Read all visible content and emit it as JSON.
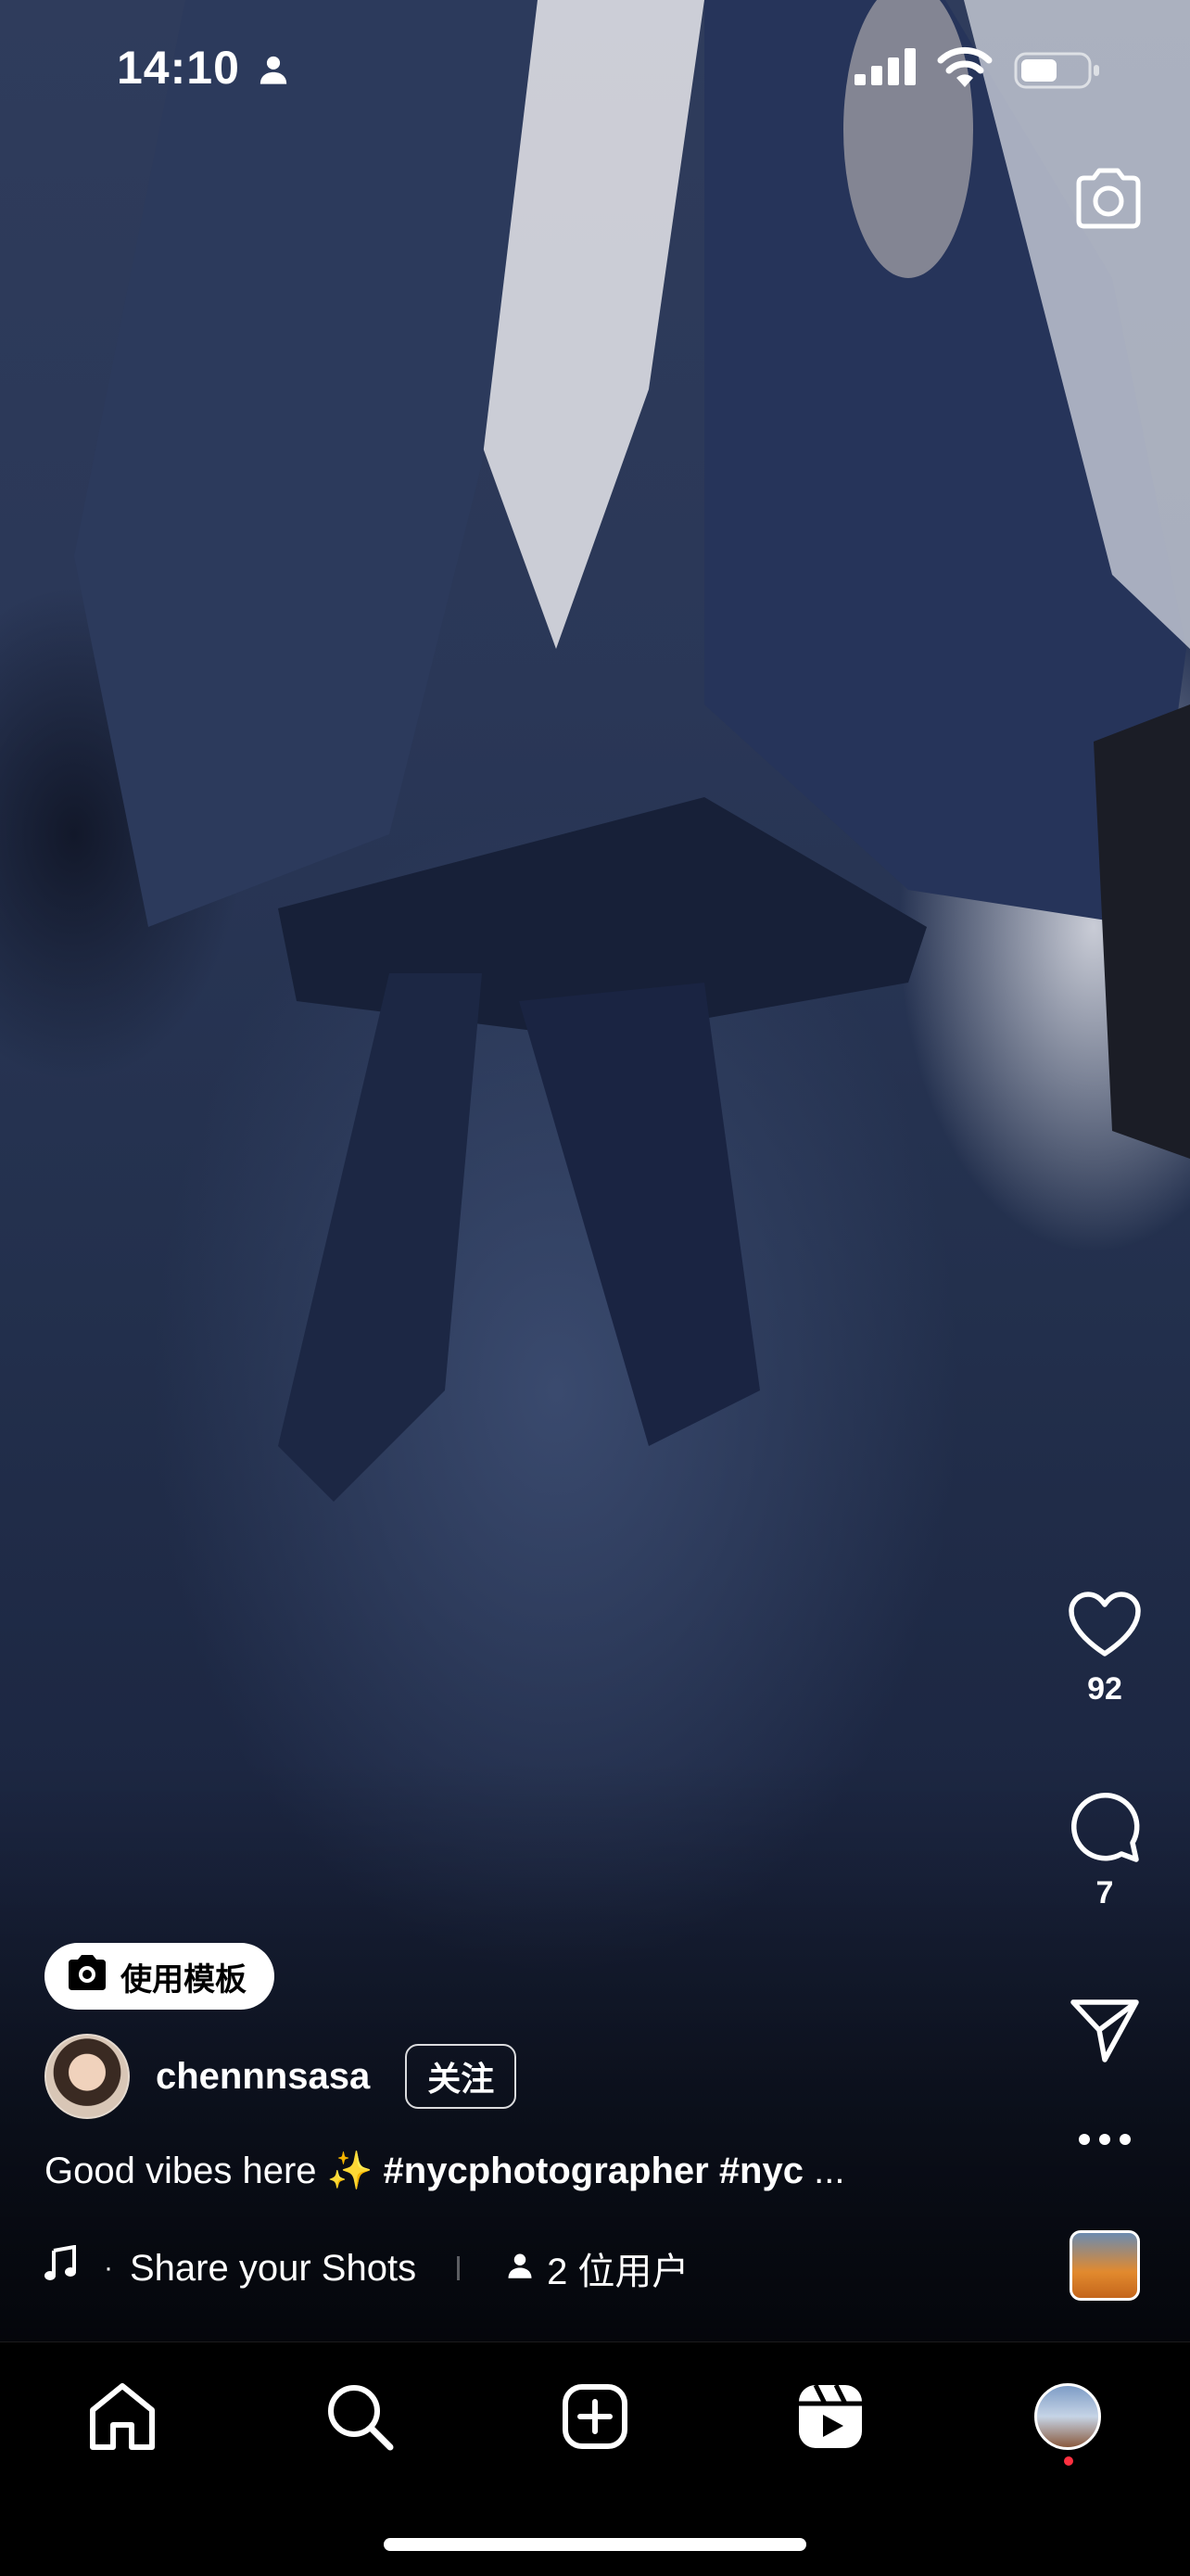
{
  "status_bar": {
    "time": "14:10"
  },
  "post": {
    "template_label": "使用模板",
    "username": "chennnsasa",
    "follow_label": "关注",
    "caption_text": "Good vibes here ✨ ",
    "caption_tags": "#nycphotographer #nyc",
    "caption_more": " ...",
    "audio_title": "Share your Shots",
    "audio_users": "2 位用户"
  },
  "actions": {
    "likes": "92",
    "comments": "7"
  },
  "icons": {
    "status": [
      "person-icon",
      "signal-icon",
      "wifi-icon",
      "battery-icon"
    ],
    "top": [
      "camera-icon"
    ],
    "side": [
      "heart-icon",
      "comment-icon",
      "send-icon",
      "more-icon"
    ],
    "tabs": [
      "home-icon",
      "search-icon",
      "create-icon",
      "reels-icon",
      "profile-avatar"
    ]
  },
  "colors": {
    "accent_notification": "#ff3040",
    "background": "#000000"
  }
}
